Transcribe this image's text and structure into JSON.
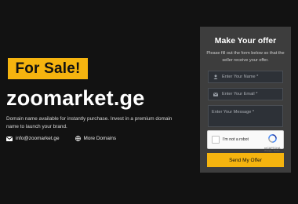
{
  "hero": {
    "badge": "For Sale!",
    "domain_name": "zoomarket.ge",
    "description": "Domain name available for instantly purchase. Invest in a premium domain name to launch your brand.",
    "email": "info@zoomarket.ge",
    "more_domains": "More Domains"
  },
  "offer_form": {
    "title": "Make Your offer",
    "subtitle": "Please fill out the form below so that the seller receive your offer.",
    "name_placeholder": "Enter Your Name *",
    "email_placeholder": "Enter Your Email *",
    "message_placeholder": "Enter Your Message *",
    "captcha_label": "I'm not a robot",
    "captcha_brand": "reCAPTCHA",
    "captcha_links": "Privacy - Terms",
    "submit_label": "Send My Offer"
  },
  "colors": {
    "accent": "#f5b40f",
    "background": "#121212",
    "panel": "#3d3d3d"
  },
  "icons": [
    "envelope-icon",
    "globe-icon",
    "user-icon",
    "mail-icon",
    "recaptcha-icon"
  ]
}
